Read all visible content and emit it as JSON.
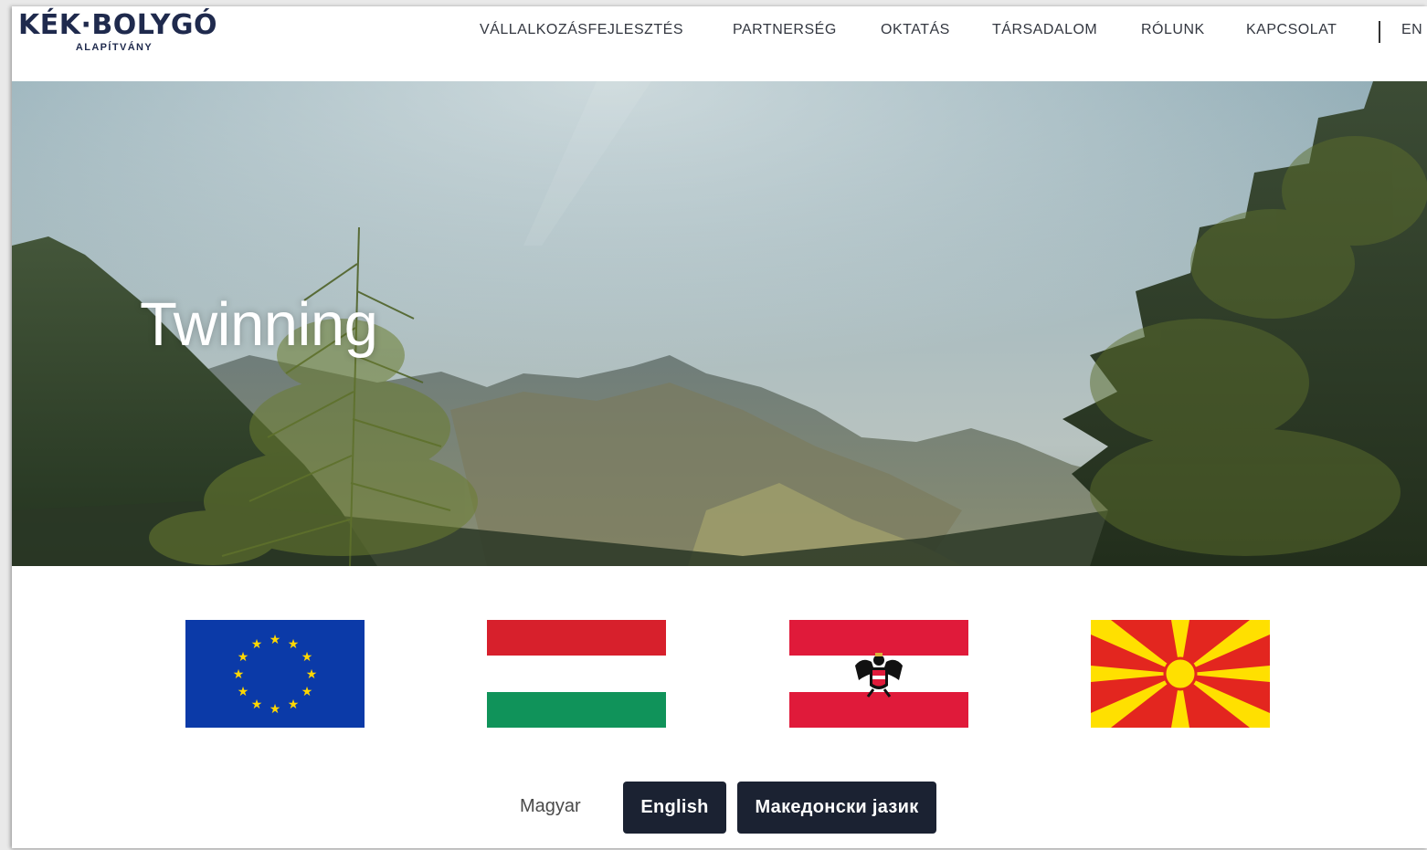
{
  "brand": {
    "name": "KÉK·BOLYGÓ",
    "subtitle": "ALAPÍTVÁNY",
    "color": "#1f2a4d"
  },
  "nav": {
    "items": [
      {
        "label": "VÁLLALKOZÁSFEJLESZTÉS"
      },
      {
        "label": "PARTNERSÉG"
      },
      {
        "label": "OKTATÁS"
      },
      {
        "label": "TÁRSADALOM"
      },
      {
        "label": "RÓLUNK"
      },
      {
        "label": "KAPCSOLAT"
      }
    ],
    "language": "EN"
  },
  "hero": {
    "title": "Twinning"
  },
  "flags": [
    {
      "icon": "eu-flag-icon"
    },
    {
      "icon": "hungary-flag-icon"
    },
    {
      "icon": "austria-flag-icon"
    },
    {
      "icon": "north-macedonia-flag-icon"
    }
  ],
  "languages": {
    "magyar": "Magyar",
    "english": "English",
    "macedonian": "Македонски јазик"
  },
  "colors": {
    "button_bg": "#1b2232",
    "eu_blue": "#0b3aa8",
    "eu_star": "#ffd700",
    "hu_red": "#d7202c",
    "hu_green": "#10935a",
    "at_red": "#e01a3a",
    "mk_red": "#e3261f",
    "mk_yellow": "#ffe000"
  }
}
